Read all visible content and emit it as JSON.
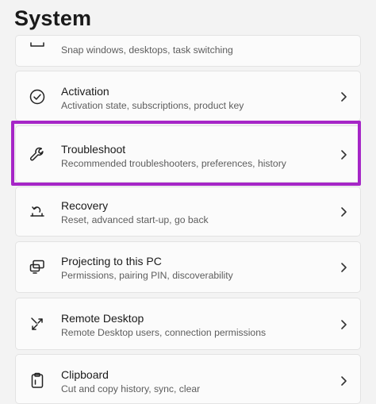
{
  "header": {
    "title": "System"
  },
  "items": [
    {
      "title": "",
      "subtitle": "Snap windows, desktops, task switching",
      "icon": "multitasking-icon"
    },
    {
      "title": "Activation",
      "subtitle": "Activation state, subscriptions, product key",
      "icon": "check-circle-icon"
    },
    {
      "title": "Troubleshoot",
      "subtitle": "Recommended troubleshooters, preferences, history",
      "icon": "wrench-icon"
    },
    {
      "title": "Recovery",
      "subtitle": "Reset, advanced start-up, go back",
      "icon": "recovery-icon"
    },
    {
      "title": "Projecting to this PC",
      "subtitle": "Permissions, pairing PIN, discoverability",
      "icon": "projecting-icon"
    },
    {
      "title": "Remote Desktop",
      "subtitle": "Remote Desktop users, connection permissions",
      "icon": "remote-desktop-icon"
    },
    {
      "title": "Clipboard",
      "subtitle": "Cut and copy history, sync, clear",
      "icon": "clipboard-icon"
    }
  ],
  "highlight_color": "#a626c7"
}
